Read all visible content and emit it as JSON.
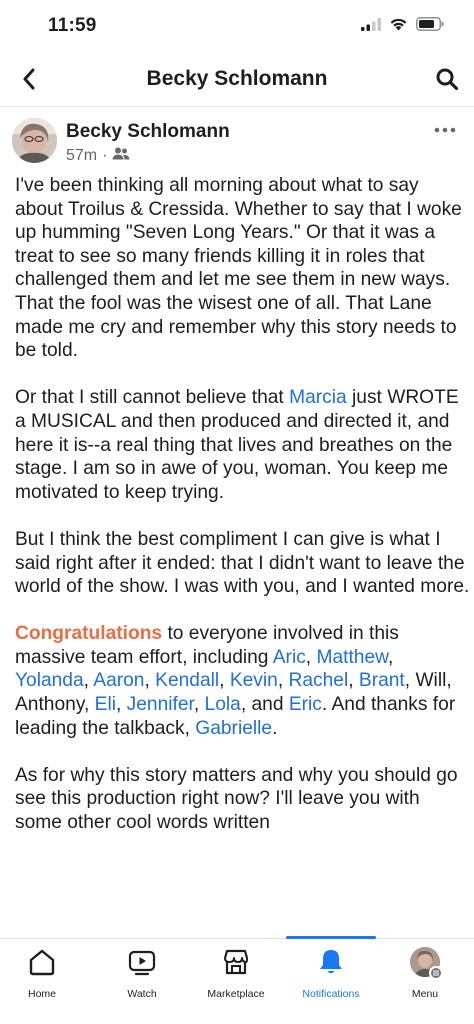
{
  "status_bar": {
    "time": "11:59"
  },
  "nav": {
    "title": "Becky Schlomann"
  },
  "post": {
    "author": "Becky Schlomann",
    "time_ago": "57m",
    "separator": "·",
    "paragraphs": [
      [
        {
          "t": "text",
          "v": "I've been thinking all morning about what to say about Troilus & Cressida. Whether to say that I woke up humming \"Seven Long Years.\" Or that it was a treat to see so many friends killing it in roles that challenged them and let me see them in new ways. That the fool was the wisest one of all. That Lane made me cry and remember why this story needs to be told."
        }
      ],
      [
        {
          "t": "text",
          "v": "Or that I still cannot believe that "
        },
        {
          "t": "tag",
          "v": "Marcia"
        },
        {
          "t": "text",
          "v": " just WROTE a MUSICAL and then produced and directed it, and here it is--a real thing that lives and breathes on the stage. I am so in awe of you, woman. You keep me motivated to keep trying."
        }
      ],
      [
        {
          "t": "text",
          "v": "But I think the best compliment I can give is what I said right after it ended: that I didn't want to leave the world of the show. I was with you, and I wanted more."
        }
      ],
      [
        {
          "t": "congrats",
          "v": "Congratulations"
        },
        {
          "t": "text",
          "v": " to everyone involved in this massive team effort, including "
        },
        {
          "t": "tag",
          "v": "Aric"
        },
        {
          "t": "text",
          "v": ", "
        },
        {
          "t": "tag",
          "v": "Matthew"
        },
        {
          "t": "text",
          "v": ", "
        },
        {
          "t": "tag",
          "v": "Yolanda"
        },
        {
          "t": "text",
          "v": ", "
        },
        {
          "t": "tag",
          "v": "Aaron"
        },
        {
          "t": "text",
          "v": ", "
        },
        {
          "t": "tag",
          "v": "Kendall"
        },
        {
          "t": "text",
          "v": ", "
        },
        {
          "t": "tag",
          "v": "Kevin"
        },
        {
          "t": "text",
          "v": ", "
        },
        {
          "t": "tag",
          "v": "Rachel"
        },
        {
          "t": "text",
          "v": ", "
        },
        {
          "t": "tag",
          "v": "Brant"
        },
        {
          "t": "text",
          "v": ", Will, Anthony, "
        },
        {
          "t": "tag",
          "v": "Eli"
        },
        {
          "t": "text",
          "v": ", "
        },
        {
          "t": "tag",
          "v": "Jennifer"
        },
        {
          "t": "text",
          "v": ", "
        },
        {
          "t": "tag",
          "v": "Lola"
        },
        {
          "t": "text",
          "v": ", and "
        },
        {
          "t": "tag",
          "v": "Eric"
        },
        {
          "t": "text",
          "v": ". And thanks for leading the talkback, "
        },
        {
          "t": "tag",
          "v": "Gabrielle"
        },
        {
          "t": "text",
          "v": "."
        }
      ],
      [
        {
          "t": "text",
          "v": "As for why this story matters and why you should go see this production right now? I'll leave you with some other cool words written"
        }
      ]
    ]
  },
  "tabbar": {
    "active": "Notifications",
    "items": [
      {
        "label": "Home",
        "icon": "home-icon"
      },
      {
        "label": "Watch",
        "icon": "watch-icon"
      },
      {
        "label": "Marketplace",
        "icon": "marketplace-icon"
      },
      {
        "label": "Notifications",
        "icon": "bell-icon"
      },
      {
        "label": "Menu",
        "icon": "menu-avatar-icon"
      }
    ]
  },
  "colors": {
    "accent": "#1877f2",
    "tag": "#216fdb",
    "congrats": "#e86e44",
    "meta": "#65676b",
    "text": "#1c1e21"
  }
}
